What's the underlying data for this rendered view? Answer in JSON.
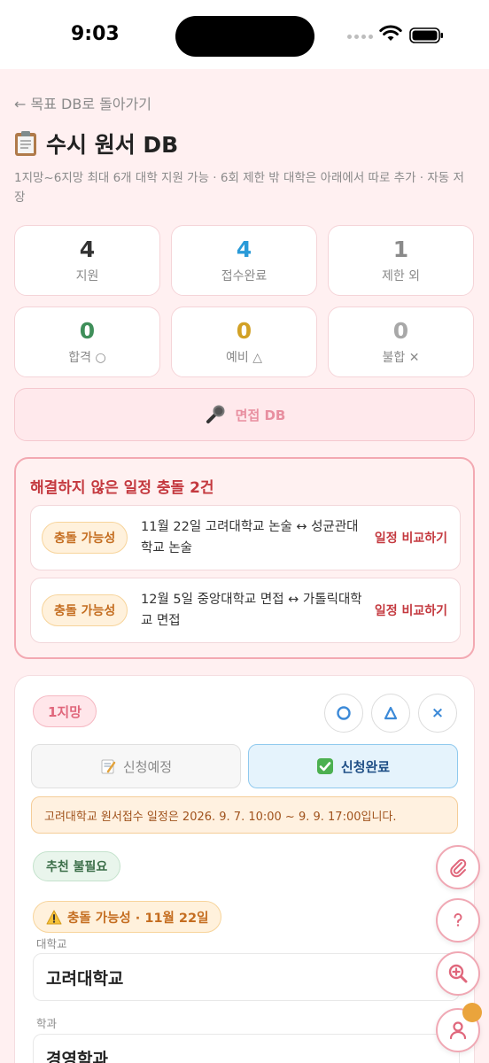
{
  "status_bar": {
    "time": "9:03"
  },
  "nav": {
    "back_label": "← 목표 DB로 돌아가기"
  },
  "header": {
    "title": "수시 원서 DB",
    "subtitle": "1지망~6지망 최대 6개 대학 지원 가능 · 6회 제한 밖 대학은 아래에서 따로 추가 · 자동 저장"
  },
  "stats": [
    {
      "value": "4",
      "label": "지원",
      "color": "#333333"
    },
    {
      "value": "4",
      "label": "접수완료",
      "color": "#2a9ad8"
    },
    {
      "value": "1",
      "label": "제한 외",
      "color": "#8a8a8a"
    },
    {
      "value": "0",
      "label": "합격 ○",
      "color": "#3f8f5a"
    },
    {
      "value": "0",
      "label": "예비 △",
      "color": "#d2a126"
    },
    {
      "value": "0",
      "label": "불합 ✕",
      "color": "#a8a8a8"
    }
  ],
  "interview_button": {
    "icon": "microphone-icon",
    "label": "면접 DB"
  },
  "conflicts": {
    "title": "해결하지 않은 일정 충돌 2건",
    "items": [
      {
        "badge": "충돌 가능성",
        "text": "11월 22일 고려대학교 논술 ↔ 성균관대학교 논술",
        "action": "일정 비교하기"
      },
      {
        "badge": "충돌 가능성",
        "text": "12월 5일 중앙대학교 면접 ↔ 가톨릭대학교 면접",
        "action": "일정 비교하기"
      }
    ]
  },
  "application_card": {
    "rank": "1지망",
    "result_buttons": [
      "○",
      "△",
      "×"
    ],
    "status_planned": {
      "icon": "memo-icon",
      "label": "신청예정"
    },
    "status_done": {
      "icon": "check-box-icon",
      "label": "신청완료"
    },
    "notice": "고려대학교 원서접수 일정은 2026. 9. 7. 10:00 ~ 9. 9. 17:00입니다.",
    "tag_recommend": "추천 불필요",
    "tag_conflict": {
      "icon": "warning-icon",
      "label": "충돌 가능성 · 11월 22일"
    },
    "university_label": "대학교",
    "university_value": "고려대학교",
    "major_label": "학과",
    "major_value": "경영학과"
  },
  "floating_buttons": [
    "paperclip-icon",
    "help-icon",
    "zoom-in-icon",
    "profile-icon"
  ],
  "colors": {
    "accent": "#f0a8b4",
    "danger": "#c4393f",
    "page_bg": "#fff0f1"
  }
}
